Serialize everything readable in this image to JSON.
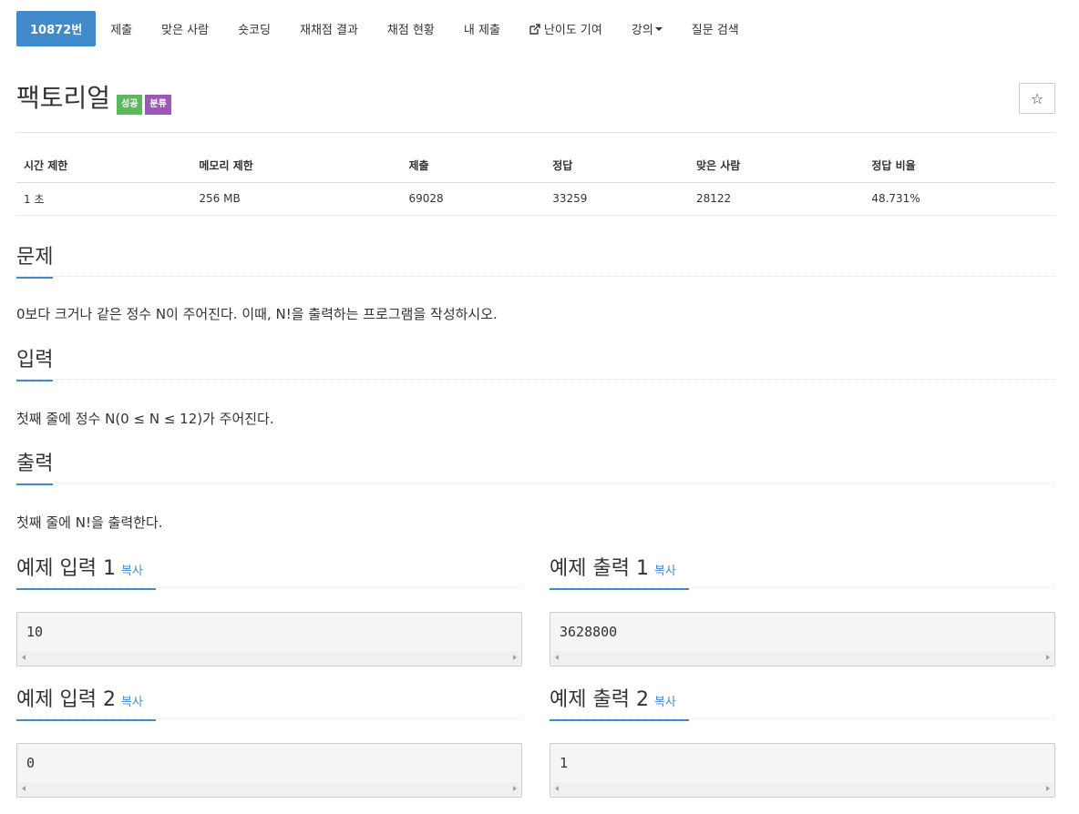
{
  "tabs": [
    {
      "label": "10872번",
      "active": true
    },
    {
      "label": "제출"
    },
    {
      "label": "맞은 사람"
    },
    {
      "label": "숏코딩"
    },
    {
      "label": "재채점 결과"
    },
    {
      "label": "채점 현황"
    },
    {
      "label": "내 제출"
    },
    {
      "label": "난이도 기여",
      "icon": "external-link-icon"
    },
    {
      "label": "강의",
      "icon": "caret-down-icon"
    },
    {
      "label": "질문 검색"
    }
  ],
  "problem": {
    "title": "팩토리얼",
    "badges": {
      "success": "성공",
      "category": "분류"
    },
    "star_icon": "☆"
  },
  "info": {
    "headers": [
      "시간 제한",
      "메모리 제한",
      "제출",
      "정답",
      "맞은 사람",
      "정답 비율"
    ],
    "values": [
      "1 초",
      "256 MB",
      "69028",
      "33259",
      "28122",
      "48.731%"
    ]
  },
  "sections": {
    "problem": {
      "title": "문제",
      "body": "0보다 크거나 같은 정수 N이 주어진다. 이때, N!을 출력하는 프로그램을 작성하시오."
    },
    "input": {
      "title": "입력",
      "body": "첫째 줄에 정수 N(0 ≤ N ≤ 12)가 주어진다."
    },
    "output": {
      "title": "출력",
      "body": "첫째 줄에 N!을 출력한다."
    }
  },
  "samples": {
    "copy_label": "복사",
    "input1_title": "예제 입력 1",
    "output1_title": "예제 출력 1",
    "input2_title": "예제 입력 2",
    "output2_title": "예제 출력 2",
    "input1": "10",
    "output1": "3628800",
    "input2": "0",
    "output2": "1"
  },
  "colors": {
    "accent": "#428bca",
    "success": "#5cb85c",
    "tag": "#9b59b6"
  }
}
